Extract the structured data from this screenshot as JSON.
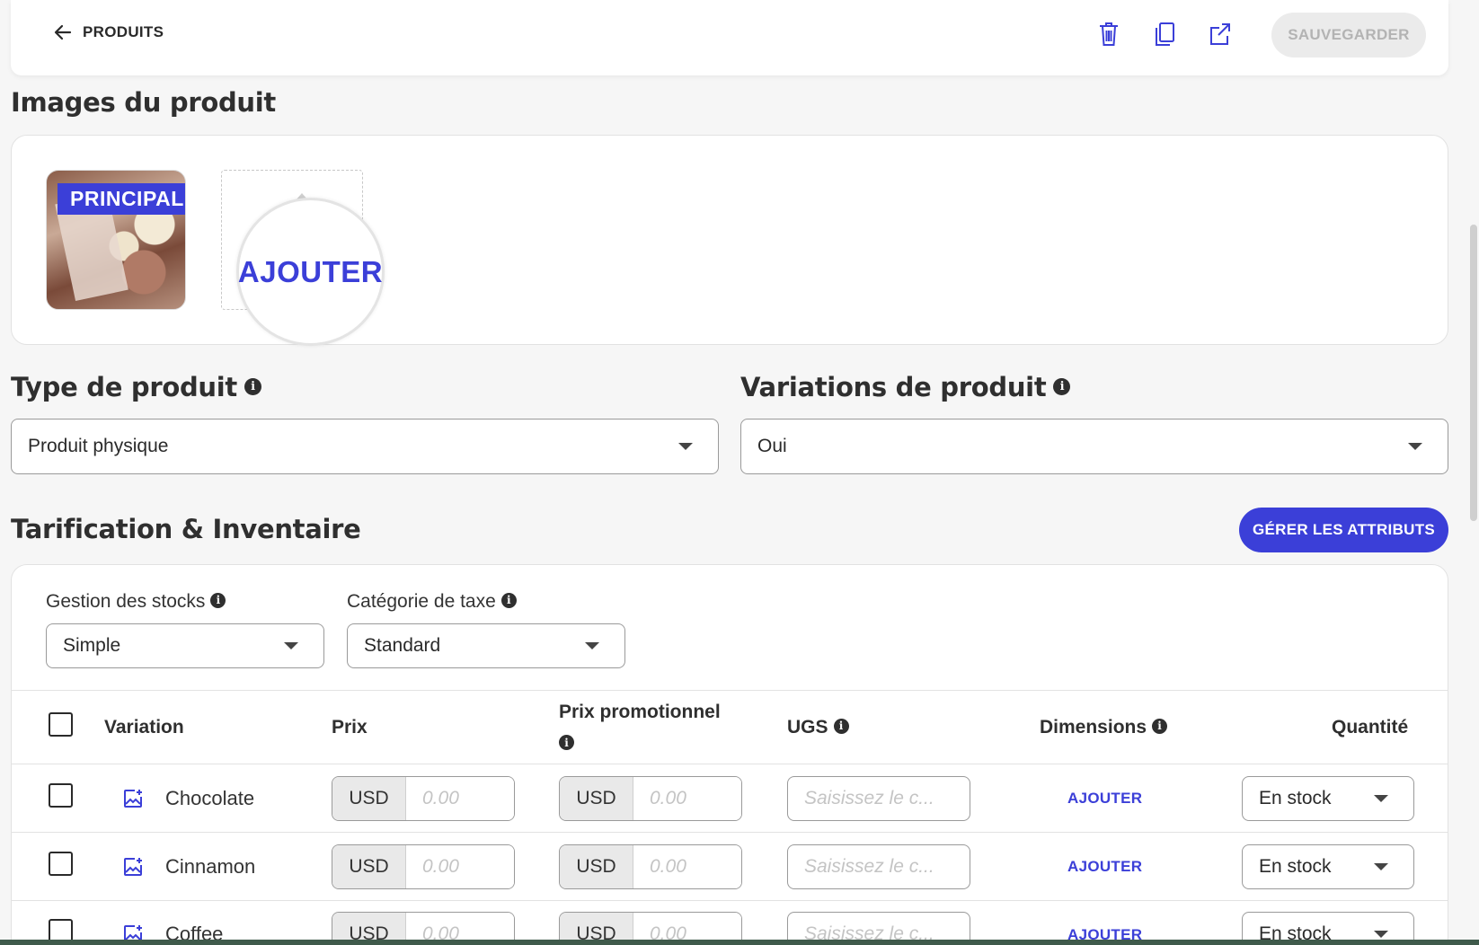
{
  "header": {
    "back_label": "PRODUITS",
    "save_label": "SAUVEGARDER",
    "icons": [
      "trash-icon",
      "duplicate-icon",
      "external-link-icon"
    ]
  },
  "images": {
    "title": "Images du produit",
    "main_badge": "PRINCIPAL",
    "add_label": "AJOUTER"
  },
  "product_type": {
    "title": "Type de produit",
    "value": "Produit physique"
  },
  "variations": {
    "title": "Variations de produit",
    "value": "Oui"
  },
  "pricing": {
    "title": "Tarification & Inventaire",
    "manage_attributes_label": "GÉRER LES ATTRIBUTS",
    "stock_management": {
      "label": "Gestion des stocks",
      "value": "Simple"
    },
    "tax_category": {
      "label": "Catégorie de taxe",
      "value": "Standard"
    },
    "table": {
      "headers": {
        "variation": "Variation",
        "price": "Prix",
        "sale_price": "Prix promotionnel",
        "sku": "UGS",
        "dimensions": "Dimensions",
        "quantity": "Quantité"
      },
      "rows": [
        {
          "name": "Chocolate",
          "currency": "USD",
          "price_placeholder": "0.00",
          "sale_currency": "USD",
          "sale_placeholder": "0.00",
          "sku_placeholder": "Saisissez le c...",
          "dimensions_label": "AJOUTER",
          "stock": "En stock"
        },
        {
          "name": "Cinnamon",
          "currency": "USD",
          "price_placeholder": "0.00",
          "sale_currency": "USD",
          "sale_placeholder": "0.00",
          "sku_placeholder": "Saisissez le c...",
          "dimensions_label": "AJOUTER",
          "stock": "En stock"
        },
        {
          "name": "Coffee",
          "currency": "USD",
          "price_placeholder": "0.00",
          "sale_currency": "USD",
          "sale_placeholder": "0.00",
          "sku_placeholder": "Saisissez le c...",
          "dimensions_label": "AJOUTER",
          "stock": "En stock"
        }
      ]
    }
  },
  "colors": {
    "accent": "#3b3fd8",
    "disabled_button": "#ebebeb",
    "background": "#f6f6f6"
  }
}
